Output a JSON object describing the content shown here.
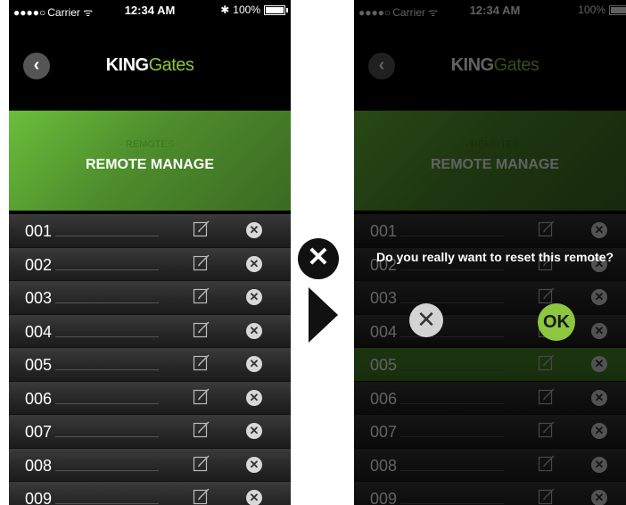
{
  "status": {
    "signal": "●●●●○",
    "carrier": "Carrier",
    "wifi": "ᯤ",
    "time": "12:34 AM",
    "bluetooth": "✱",
    "battery": "100%"
  },
  "header": {
    "back_icon": "‹",
    "brand_part1": "KING",
    "brand_part2": "Gates"
  },
  "banner": {
    "subtitle": "- REMOTES -",
    "title": "REMOTE MANAGE"
  },
  "remotes": [
    {
      "label": "001"
    },
    {
      "label": "002"
    },
    {
      "label": "003"
    },
    {
      "label": "004"
    },
    {
      "label": "005"
    },
    {
      "label": "006"
    },
    {
      "label": "007"
    },
    {
      "label": "008"
    },
    {
      "label": "009"
    }
  ],
  "row_delete_glyph": "✕",
  "dialog": {
    "message": "Do you really want to reset this remote?",
    "cancel_glyph": "✕",
    "ok_label": "OK"
  },
  "annotation": {
    "x_glyph": "✕"
  },
  "colors": {
    "accent": "#8dc63f",
    "banner_green": "#5aa534"
  }
}
